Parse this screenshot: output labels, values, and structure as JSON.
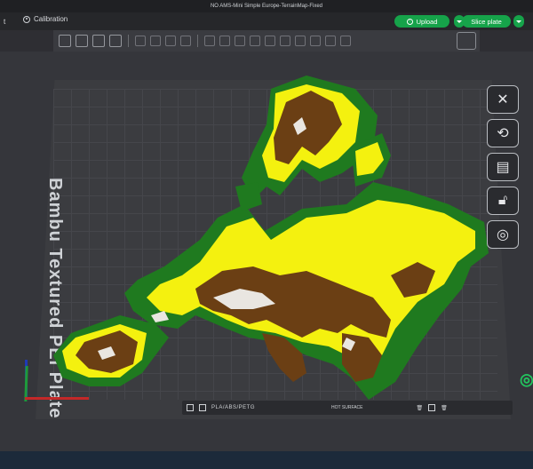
{
  "window": {
    "title": "NO AMS-Mini Simple Europe-TerrainMap-Fixed"
  },
  "menu": {
    "left_fragment": "t",
    "calibration": "Calibration"
  },
  "actions": {
    "upload": "Upload",
    "slice": "Slice plate"
  },
  "plate": {
    "text": "Bambu Textured PEI Plate",
    "label": "PLA/ABS/PETG",
    "surface": "HOT SURFACE"
  },
  "colors": {
    "accent": "#16a34a",
    "ocean": "#3b3c40",
    "green": "#1f7a1f",
    "yellow": "#f4f10f",
    "brown": "#6b3f14",
    "white": "#e9e6e1"
  }
}
